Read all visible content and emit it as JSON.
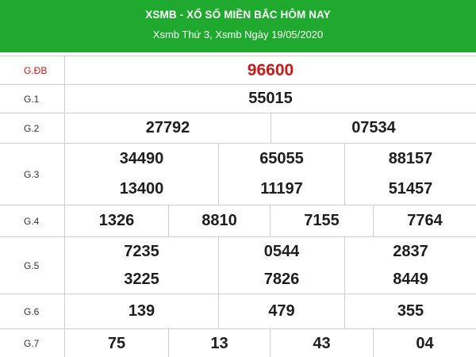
{
  "header": {
    "title": "XSMB - XỔ SỐ MIỀN BẮC HÔM NAY",
    "subtitle": "Xsmb Thứ 3, Xsmb Ngày 19/05/2020",
    "bg_color": "#20a92f"
  },
  "colors": {
    "special": "#c51b1b",
    "text": "#1e1e1e",
    "border": "#cfcfcf"
  },
  "prizes": {
    "db": {
      "label": "G.ĐB",
      "values": [
        "96600"
      ]
    },
    "g1": {
      "label": "G.1",
      "values": [
        "55015"
      ]
    },
    "g2": {
      "label": "G.2",
      "values": [
        "27792",
        "07534"
      ]
    },
    "g3": {
      "label": "G.3",
      "values": [
        "34490",
        "65055",
        "88157",
        "13400",
        "11197",
        "51457"
      ]
    },
    "g4": {
      "label": "G.4",
      "values": [
        "1326",
        "8810",
        "7155",
        "7764"
      ]
    },
    "g5": {
      "label": "G.5",
      "values": [
        "7235",
        "0544",
        "2837",
        "3225",
        "7826",
        "8449"
      ]
    },
    "g6": {
      "label": "G.6",
      "values": [
        "139",
        "479",
        "355"
      ]
    },
    "g7": {
      "label": "G.7",
      "values": [
        "75",
        "13",
        "43",
        "04"
      ]
    }
  }
}
